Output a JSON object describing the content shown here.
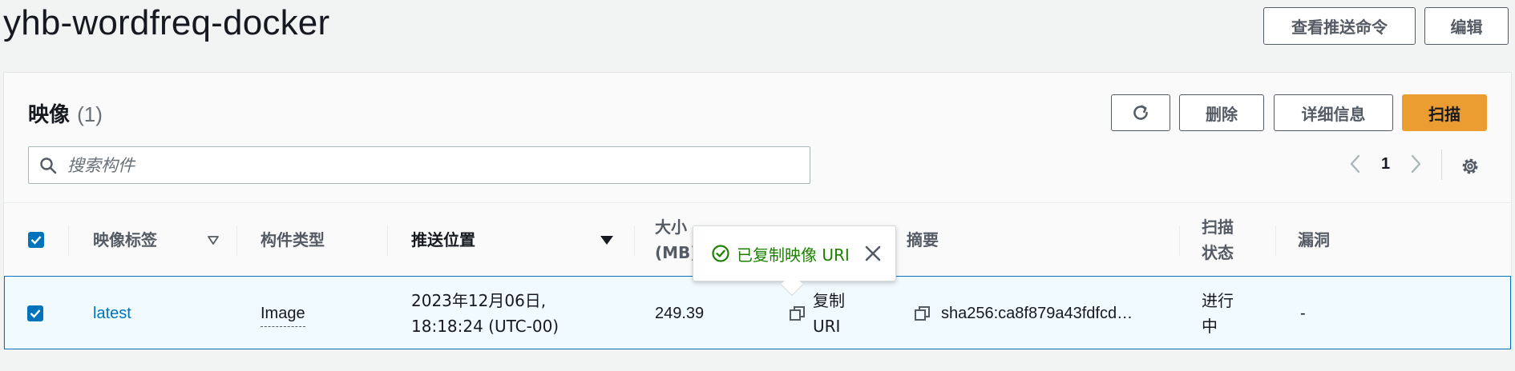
{
  "page_title": "yhb-wordfreq-docker",
  "header_actions": {
    "view_push_commands": "查看推送命令",
    "edit": "编辑"
  },
  "panel": {
    "title": "映像",
    "count": "(1)",
    "actions": {
      "refresh_icon": "refresh-icon",
      "delete": "删除",
      "details": "详细信息",
      "scan": "扫描"
    },
    "search": {
      "placeholder": "搜索构件",
      "value": ""
    },
    "pagination": {
      "current_page": "1"
    }
  },
  "table": {
    "headers": {
      "tag": "映像标签",
      "artifact_type": "构件类型",
      "pushed_at": "推送位置",
      "size_line1": "大小",
      "size_line2": "(MB)",
      "digest": "摘要",
      "scan_status_line1": "扫描",
      "scan_status_line2": "状态",
      "vulnerabilities": "漏洞"
    },
    "rows": [
      {
        "selected": true,
        "tag": "latest",
        "artifact_type": "Image",
        "pushed_at_line1": "2023年12月06日,",
        "pushed_at_line2": "18:18:24 (UTC-00)",
        "size": "249.39",
        "copy_uri_line1": "复制",
        "copy_uri_line2": "URI",
        "digest": "sha256:ca8f879a43fdfcd…",
        "scan_status_line1": "进行",
        "scan_status_line2": "中",
        "vulnerabilities": "-"
      }
    ]
  },
  "popover": {
    "text": "已复制映像 URI"
  },
  "colors": {
    "accent": "#0073bb",
    "primary_button": "#ec9d32",
    "success": "#1d8102",
    "text_secondary": "#545b64"
  }
}
